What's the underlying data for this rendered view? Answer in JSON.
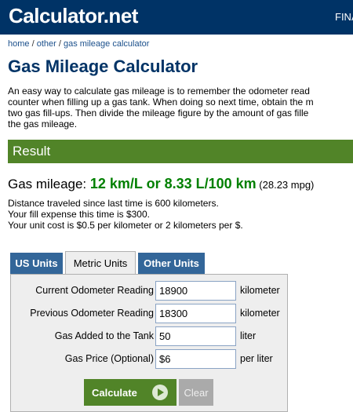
{
  "header": {
    "logo": "Calculator.net",
    "nav_link": "FINA"
  },
  "breadcrumb": [
    "home",
    "other",
    "gas mileage calculator"
  ],
  "title": "Gas Mileage Calculator",
  "intro_lines": [
    "An easy way to calculate gas mileage is to remember the odometer read",
    "counter when filling up a gas tank. When doing so next time, obtain the m",
    "two gas fill-ups. Then divide the mileage figure by the amount of gas fille",
    "the gas mileage."
  ],
  "result": {
    "heading": "Result",
    "label": "Gas mileage: ",
    "value": "12 km/L or 8.33 L/100 km",
    "mpg": " (28.23 mpg)",
    "details": [
      "Distance traveled since last time is 600 kilometers.",
      "Your fill expense this time is $300.",
      "Your unit cost is $0.5 per kilometer or 2 kilometers per $."
    ]
  },
  "tabs": [
    "US Units",
    "Metric Units",
    "Other Units"
  ],
  "active_tab": "Metric Units",
  "form": {
    "fields": [
      {
        "label": "Current Odometer Reading",
        "value": "18900",
        "unit": "kilometer"
      },
      {
        "label": "Previous Odometer Reading",
        "value": "18300",
        "unit": "kilometer"
      },
      {
        "label": "Gas Added to the Tank",
        "value": "50",
        "unit": "liter"
      },
      {
        "label": "Gas Price (Optional)",
        "value": "$6",
        "unit": "per liter"
      }
    ],
    "calculate_label": "Calculate",
    "clear_label": "Clear"
  },
  "colors": {
    "header_bg": "#003366",
    "accent_green": "#518428",
    "tab_blue": "#336699",
    "result_green": "#008000"
  },
  "icons": {
    "calculate": "play-icon"
  }
}
